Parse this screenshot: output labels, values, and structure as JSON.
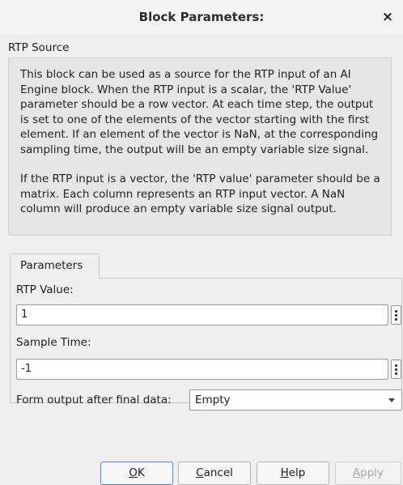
{
  "window": {
    "title": "Block Parameters:",
    "close_glyph": "×"
  },
  "block": {
    "name": "RTP Source",
    "description": [
      "This block can be used as a source for the RTP input of an AI Engine block. When the RTP input is a scalar, the 'RTP Value' parameter should be a row vector. At each time step, the output is set to one of the elements of the vector starting with the first element. If an element of the vector is NaN, at the corresponding sampling time, the output will be an empty variable size signal.",
      "If the RTP input is a vector, the 'RTP value' parameter should be a matrix. Each column represents an RTP input vector. A NaN column will produce an empty variable size signal output."
    ]
  },
  "tabs": [
    {
      "label": "Parameters",
      "active": true
    }
  ],
  "params": {
    "rtp_value": {
      "label": "RTP Value:",
      "value": "1"
    },
    "sample_time": {
      "label": "Sample Time:",
      "value": "-1"
    },
    "form_output": {
      "label": "Form output after final data:",
      "selected": "Empty"
    }
  },
  "buttons": {
    "ok": {
      "mnemonic": "O",
      "rest": "K"
    },
    "cancel": {
      "mnemonic": "C",
      "rest": "ancel"
    },
    "help": {
      "mnemonic": "H",
      "rest": "elp"
    },
    "apply": {
      "mnemonic": "A",
      "rest": "pply",
      "disabled": true
    }
  },
  "colors": {
    "focus_border": "#4a90d9",
    "background": "#efefef"
  }
}
